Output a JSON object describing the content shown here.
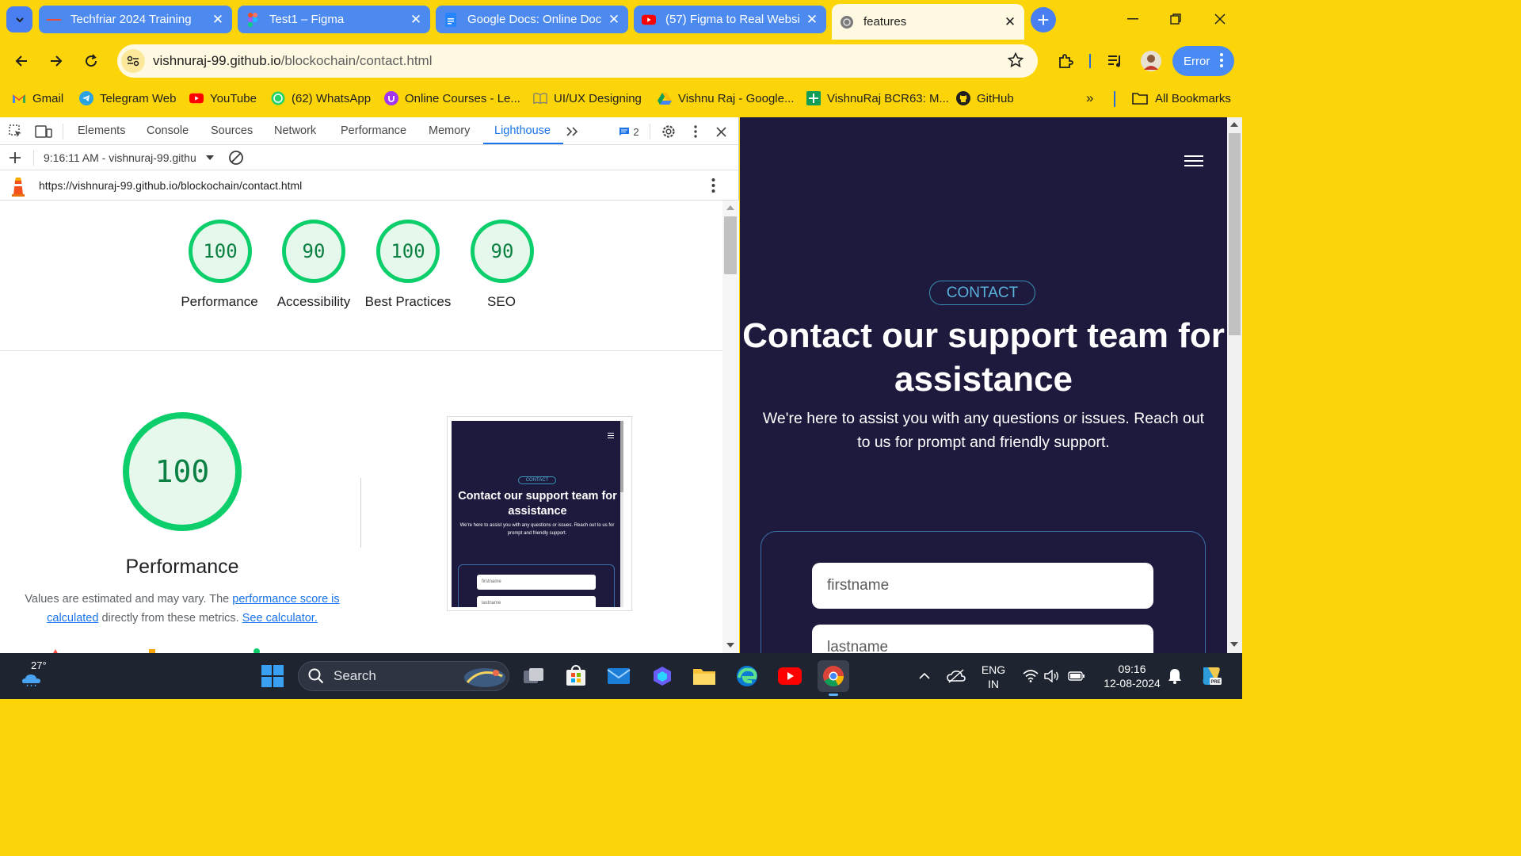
{
  "browser": {
    "tabs": [
      {
        "title": "Techfriar 2024 Training",
        "icon": "techfriar-icon"
      },
      {
        "title": "Test1 – Figma",
        "icon": "figma-icon"
      },
      {
        "title": "Google Docs: Online Doc",
        "icon": "google-docs-icon"
      },
      {
        "title": "(57) Figma to Real Websi",
        "icon": "youtube-icon"
      },
      {
        "title": "features",
        "icon": "globe-icon"
      }
    ],
    "active_tab_index": 4,
    "url_host": "vishnuraj-99.github.io",
    "url_path": "/blockochain/contact.html",
    "profile_status": "Error",
    "bookmarks": [
      {
        "label": "Gmail",
        "icon": "gmail-icon"
      },
      {
        "label": "Telegram Web",
        "icon": "telegram-icon"
      },
      {
        "label": "YouTube",
        "icon": "youtube-icon"
      },
      {
        "label": "(62) WhatsApp",
        "icon": "whatsapp-icon"
      },
      {
        "label": "Online Courses - Le...",
        "icon": "udemy-icon"
      },
      {
        "label": "UI/UX Designing",
        "icon": "book-icon"
      },
      {
        "label": "Vishnu Raj - Google...",
        "icon": "drive-icon"
      },
      {
        "label": "VishnuRaj BCR63: M...",
        "icon": "sheets-icon"
      },
      {
        "label": "GitHub",
        "icon": "github-icon"
      }
    ],
    "all_bookmarks": "All Bookmarks",
    "colors": {
      "chrome_yellow": "#fbd50a",
      "tab_blue": "#4d8af0"
    }
  },
  "devtools": {
    "tabs": [
      "Elements",
      "Console",
      "Sources",
      "Network",
      "Performance",
      "Memory",
      "Lighthouse"
    ],
    "active_tab": "Lighthouse",
    "issues_count": "2",
    "report_time": "9:16:11 AM - vishnuraj-99.githu",
    "report_url": "https://vishnuraj-99.github.io/blockochain/contact.html",
    "scores": [
      {
        "value": "100",
        "label": "Performance"
      },
      {
        "value": "90",
        "label": "Accessibility"
      },
      {
        "value": "100",
        "label": "Best Practices"
      },
      {
        "value": "90",
        "label": "SEO"
      }
    ],
    "performance": {
      "score": "100",
      "title": "Performance",
      "note_prefix": "Values are estimated and may vary. The ",
      "note_link1": "performance score is calculated",
      "note_mid": " directly from these metrics. ",
      "note_link2": "See calculator."
    },
    "thumbnail": {
      "pill": "CONTACT",
      "heading": "Contact our support team for assistance",
      "sub": "We're here to assist you with any questions or issues. Reach out to us for prompt and friendly support.",
      "input1": "firstname",
      "input2": "lastname"
    },
    "colors": {
      "pass_green": "#0cce6b",
      "link_blue": "#1a73e8"
    }
  },
  "page": {
    "pill": "CONTACT",
    "heading": "Contact our support team for assistance",
    "sub": "We're here to assist you with any questions or issues. Reach out to us for prompt and friendly support.",
    "firstname_placeholder": "firstname",
    "lastname_placeholder": "lastname",
    "colors": {
      "background": "#1d1a3d",
      "accent": "#5ab1db"
    }
  },
  "taskbar": {
    "weather": "27°",
    "search_label": "Search",
    "lang_line1": "ENG",
    "lang_line2": "IN",
    "time": "09:16",
    "date": "12-08-2024"
  }
}
